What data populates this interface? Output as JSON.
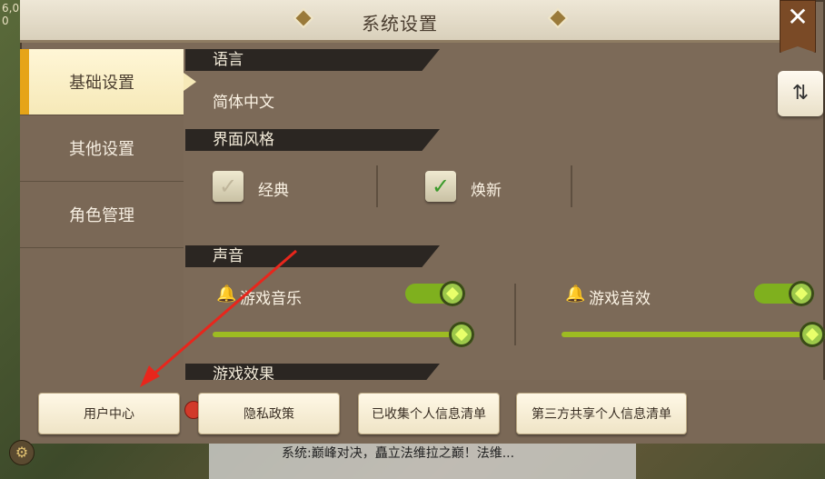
{
  "title": "系统设置",
  "corner_text": "6,0\n0",
  "close_icon": "close-icon",
  "sidebar": {
    "tabs": [
      {
        "label": "基础设置",
        "active": true
      },
      {
        "label": "其他设置",
        "active": false
      },
      {
        "label": "角色管理",
        "active": false
      }
    ]
  },
  "sections": {
    "language": {
      "heading": "语言",
      "value": "简体中文"
    },
    "style": {
      "heading": "界面风格",
      "options": [
        {
          "label": "经典",
          "checked": false
        },
        {
          "label": "焕新",
          "checked": true
        }
      ]
    },
    "sound": {
      "heading": "声音",
      "music_label": "游戏音乐",
      "effects_label": "游戏音效",
      "music_volume": 1.0,
      "effects_volume": 1.0
    },
    "effects": {
      "heading": "游戏效果"
    }
  },
  "footer_buttons": {
    "user_center": "用户中心",
    "privacy": "隐私政策",
    "collected": "已收集个人信息清单",
    "third_party": "第三方共享个人信息清单"
  },
  "ticker": "系统:巅峰对决，矗立法维拉之巅！法维...",
  "colors": {
    "accent": "#e6a418",
    "toggle_green": "#7fb01e",
    "badge_red": "#d23a2a",
    "annotation_arrow": "#e8261c"
  }
}
